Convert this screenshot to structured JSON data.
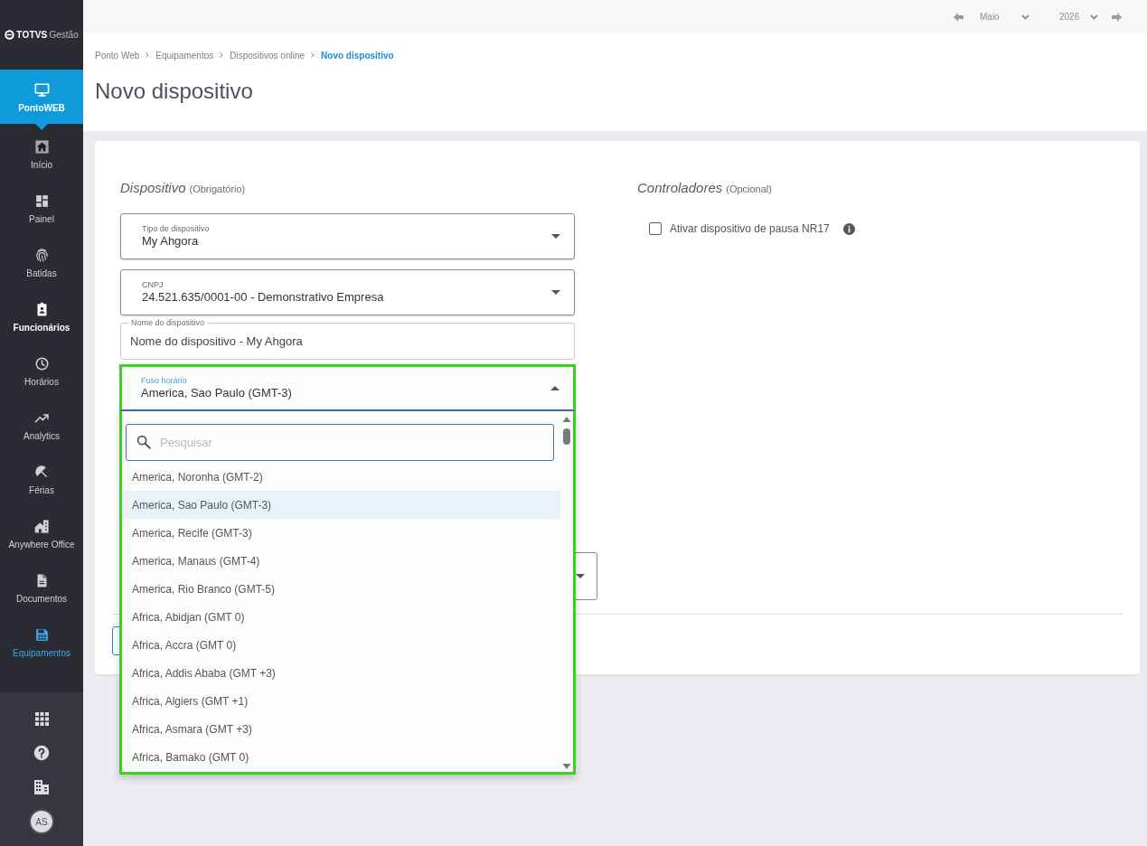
{
  "sidebar": {
    "logo": {
      "brand": "TOTVS",
      "product": "Gestão"
    },
    "module": {
      "label": "PontoWEB",
      "selected": true
    },
    "items": [
      {
        "label": "Início",
        "selected": false,
        "hovered": false
      },
      {
        "label": "Painel",
        "selected": false,
        "hovered": false
      },
      {
        "label": "Batidas",
        "selected": false,
        "hovered": false
      },
      {
        "label": "Funcionários",
        "selected": false,
        "hovered": true
      },
      {
        "label": "Horários",
        "selected": false,
        "hovered": false
      },
      {
        "label": "Analytics",
        "selected": false,
        "hovered": false
      },
      {
        "label": "Férias",
        "selected": false,
        "hovered": false
      },
      {
        "label": "Anywhere Office",
        "selected": false,
        "hovered": false
      },
      {
        "label": "Documentos",
        "selected": false,
        "hovered": false
      },
      {
        "label": "Equipamentos",
        "selected": true,
        "hovered": false
      }
    ],
    "footer": {
      "avatar": "AS"
    }
  },
  "top_bar": {
    "month": "Maio",
    "year": "2026"
  },
  "breadcrumb": [
    {
      "label": "Ponto Web",
      "selected": false
    },
    {
      "label": "Equipamentos",
      "selected": false
    },
    {
      "label": "Dispositivos online",
      "selected": false
    },
    {
      "label": "Novo dispositivo",
      "selected": true
    }
  ],
  "page_title": "Novo dispositivo",
  "form": {
    "device_section": {
      "title": "Dispositivo",
      "note": "(Obrigatório)",
      "fields": [
        {
          "kind": "select",
          "label": "Tipo de dispositivo",
          "value": "My Ahgora",
          "expanded": false
        },
        {
          "kind": "select",
          "label": "CNPJ",
          "value": "24.521.635/0001-00 - Demonstrativo Empresa",
          "expanded": false
        },
        {
          "kind": "text",
          "label": "Nome do dispositivo",
          "value": "Nome do dispositivo - My Ahgora"
        },
        {
          "kind": "select",
          "label": "Fuso horário",
          "value": "America, Sao Paulo (GMT-3)",
          "expanded": true,
          "search": {
            "placeholder": "Pesquisar"
          },
          "options": [
            {
              "label": "America, Noronha (GMT-2)",
              "selected": false
            },
            {
              "label": "America, Sao Paulo (GMT-3)",
              "selected": true
            },
            {
              "label": "America, Recife (GMT-3)",
              "selected": false
            },
            {
              "label": "America, Manaus (GMT-4)",
              "selected": false
            },
            {
              "label": "America, Rio Branco (GMT-5)",
              "selected": false
            },
            {
              "label": "Africa, Abidjan (GMT 0)",
              "selected": false
            },
            {
              "label": "Africa, Accra (GMT 0)",
              "selected": false
            },
            {
              "label": "Africa, Addis Ababa (GMT +3)",
              "selected": false
            },
            {
              "label": "Africa, Algiers (GMT +1)",
              "selected": false
            },
            {
              "label": "Africa, Asmara (GMT +3)",
              "selected": false
            },
            {
              "label": "Africa, Bamako (GMT 0)",
              "selected": false
            }
          ]
        }
      ]
    },
    "controllers_section": {
      "title": "Controladores",
      "note": "(Opcional)",
      "checkbox": {
        "label": "Ativar dispositivo de pausa NR17",
        "checked": false
      }
    }
  }
}
